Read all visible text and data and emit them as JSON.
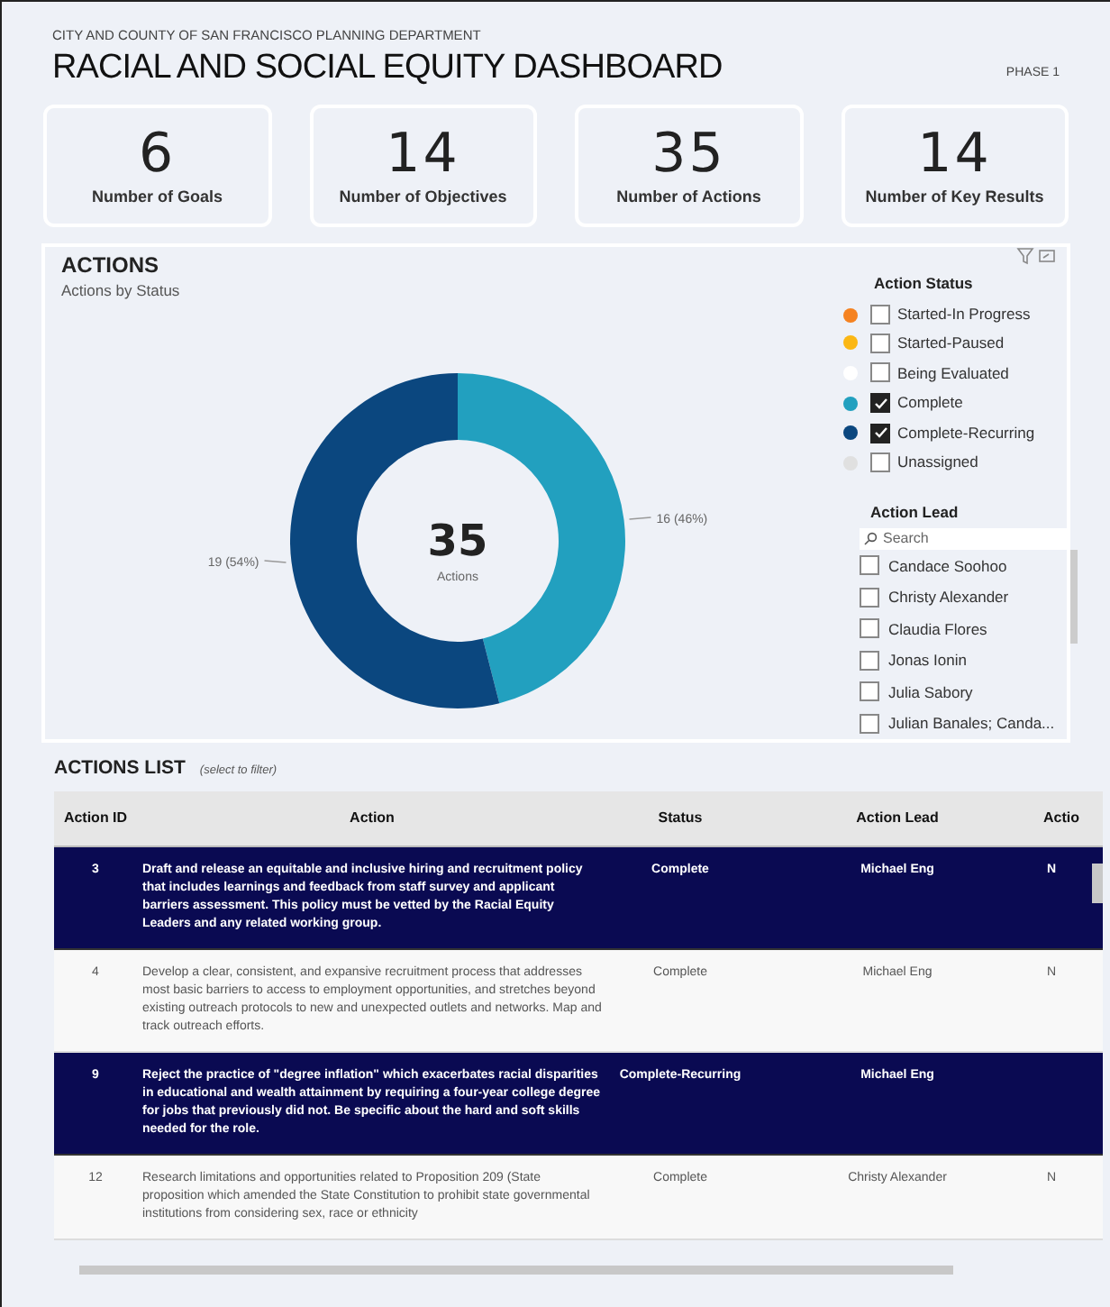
{
  "header": {
    "department": "CITY AND COUNTY OF SAN FRANCISCO PLANNING DEPARTMENT",
    "title": "RACIAL AND SOCIAL EQUITY DASHBOARD",
    "phase": "PHASE 1"
  },
  "cards": [
    {
      "value": "6",
      "label": "Number of Goals"
    },
    {
      "value": "14",
      "label": "Number of Objectives"
    },
    {
      "value": "35",
      "label": "Number of Actions"
    },
    {
      "value": "14",
      "label": "Number of Key Results"
    }
  ],
  "actions": {
    "title": "ACTIONS",
    "subtitle": "Actions by Status",
    "total": "35",
    "total_label": "Actions",
    "chart_data": {
      "type": "donut",
      "values": [
        46,
        54
      ],
      "colors": [
        "#22a0bf",
        "#0b477f"
      ],
      "value_labels": [
        "16 (46%)",
        "19 (54%)"
      ]
    },
    "status_filter": {
      "title": "Action Status",
      "items": [
        {
          "label": "Started-In Progress",
          "color": "#f58220",
          "checked": false
        },
        {
          "label": "Started-Paused",
          "color": "#fbb714",
          "checked": false
        },
        {
          "label": "Being Evaluated",
          "color": "#ffffff",
          "checked": false
        },
        {
          "label": "Complete",
          "color": "#22a0bf",
          "checked": true
        },
        {
          "label": "Complete-Recurring",
          "color": "#0b477f",
          "checked": true
        },
        {
          "label": "Unassigned",
          "color": "#e0e0e0",
          "checked": false
        }
      ]
    },
    "lead_filter": {
      "title": "Action Lead",
      "search_placeholder": "Search",
      "items": [
        {
          "label": "Candace Soohoo",
          "checked": false
        },
        {
          "label": "Christy Alexander",
          "checked": false
        },
        {
          "label": "Claudia Flores",
          "checked": false
        },
        {
          "label": "Jonas Ionin",
          "checked": false
        },
        {
          "label": "Julia Sabory",
          "checked": false
        },
        {
          "label": "Julian Banales; Canda...",
          "checked": false
        }
      ]
    }
  },
  "actions_list": {
    "title": "ACTIONS LIST",
    "hint": "(select to filter)",
    "columns": [
      "Action ID",
      "Action",
      "Status",
      "Action Lead",
      "Actio"
    ],
    "rows": [
      {
        "selected": true,
        "cells": [
          "3",
          "Draft and release an equitable and inclusive hiring and recruitment policy that includes learnings and feedback from staff survey and applicant barriers assessment. This policy must be vetted by the Racial Equity Leaders and any related working group.",
          "Complete",
          "Michael Eng",
          "N"
        ]
      },
      {
        "selected": false,
        "cells": [
          "4",
          "Develop a clear, consistent, and expansive recruitment process that addresses most basic barriers to access to employment opportunities, and stretches beyond existing outreach protocols to new and unexpected outlets and networks. Map and track outreach efforts.",
          "Complete",
          "Michael Eng",
          "N"
        ]
      },
      {
        "selected": true,
        "cells": [
          "9",
          "Reject the practice of \"degree inflation\" which exacerbates racial disparities in educational and wealth attainment by requiring a four-year college degree for jobs that previously did not.  Be specific about the hard and soft skills needed for the role.",
          "Complete-Recurring",
          "Michael Eng",
          ""
        ]
      },
      {
        "selected": false,
        "cells": [
          "12",
          "Research limitations and opportunities related to Proposition 209 (State proposition which amended the State Constitution to prohibit state governmental institutions from considering sex, race or ethnicity",
          "Complete",
          "Christy Alexander",
          "N"
        ]
      }
    ]
  }
}
